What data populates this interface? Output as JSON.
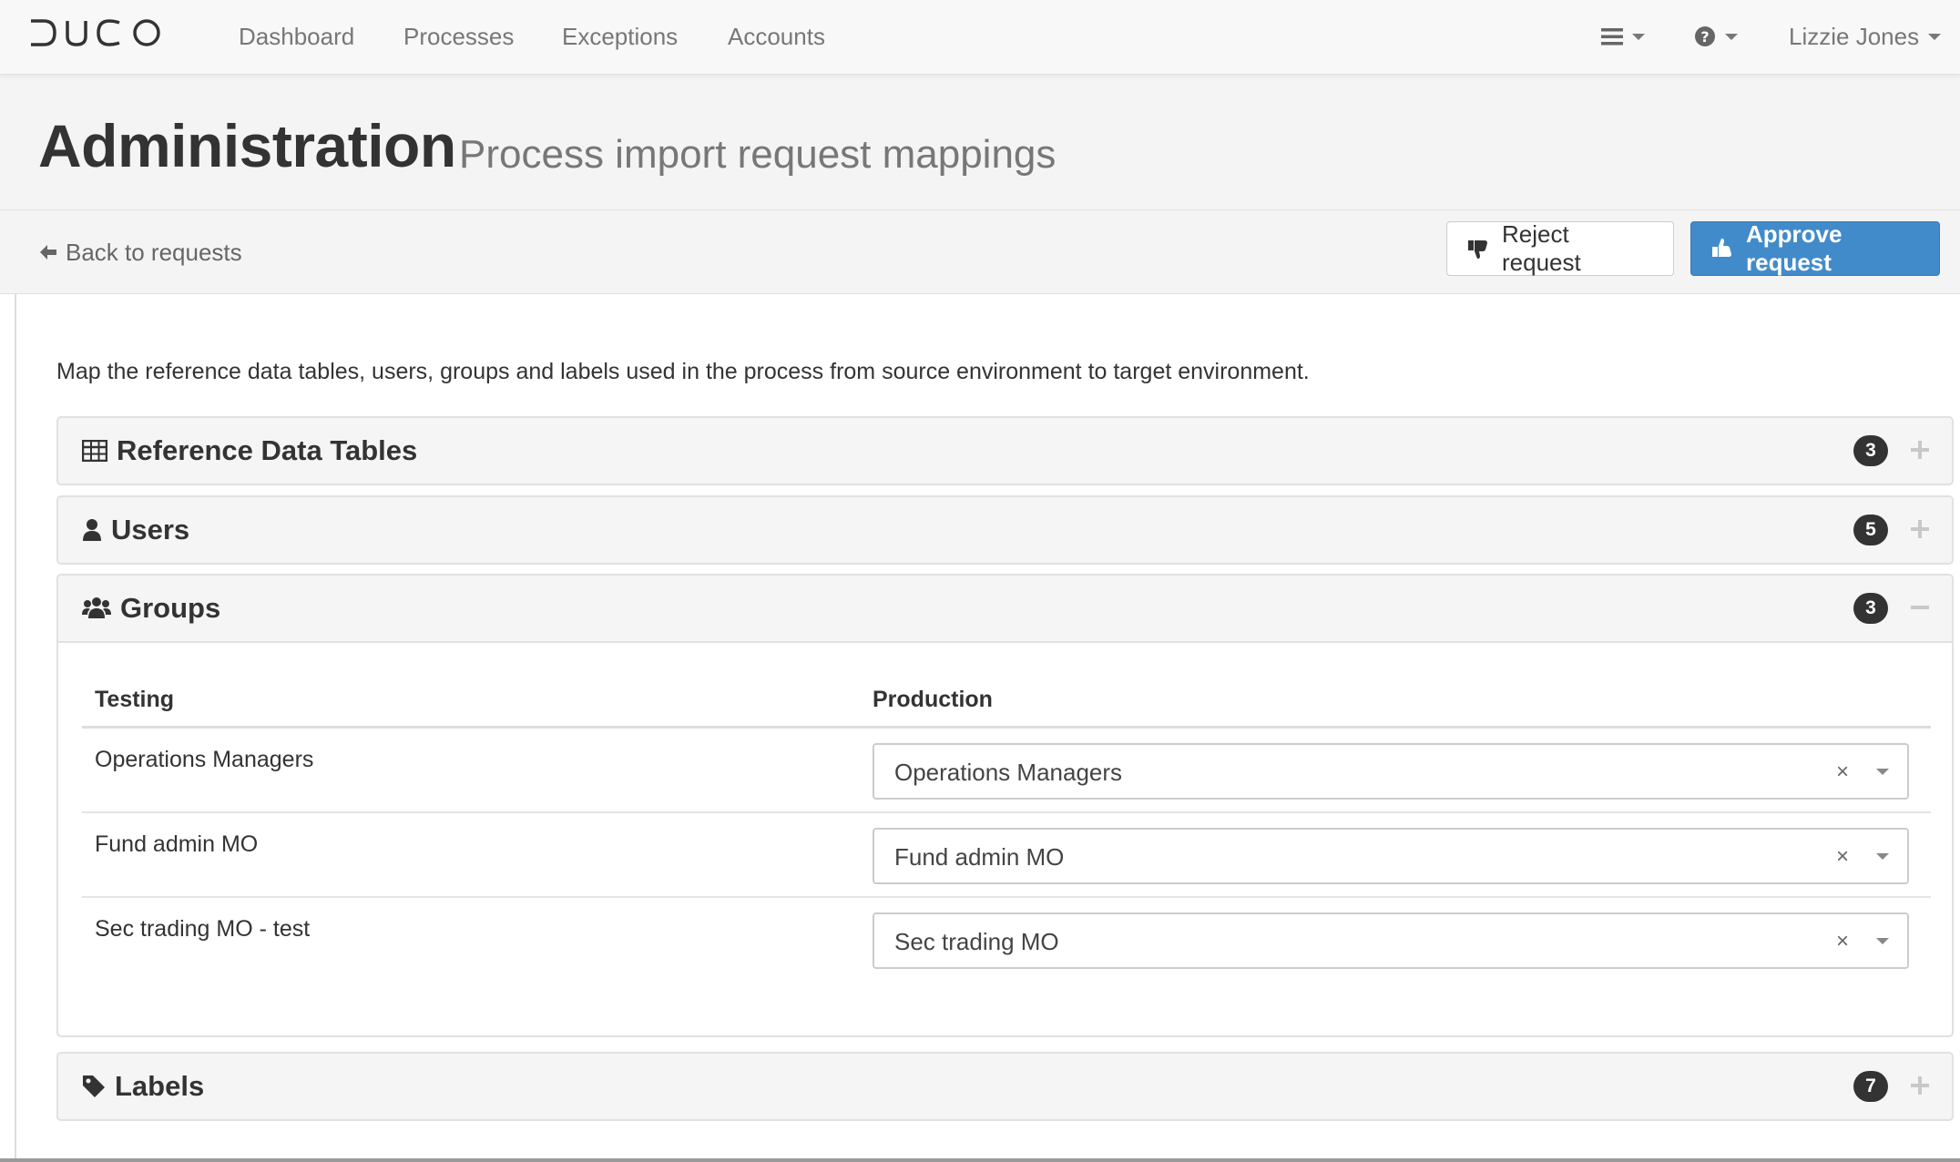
{
  "brand": {
    "logo_text": "DUCO"
  },
  "nav": {
    "items": [
      {
        "label": "Dashboard"
      },
      {
        "label": "Processes"
      },
      {
        "label": "Exceptions"
      },
      {
        "label": "Accounts"
      }
    ],
    "menu_icon": "hamburger-menu-icon",
    "help_icon": "question-circle-icon",
    "user_name": "Lizzie Jones"
  },
  "header": {
    "title": "Administration",
    "subtitle": "Process import request mappings"
  },
  "actions": {
    "back_label": "Back to requests",
    "reject_label": "Reject request",
    "approve_label": "Approve request",
    "approve_color": "#428bca"
  },
  "intro_text": "Map the reference data tables, users, groups and labels used in the process from source environment to target environment.",
  "panels": {
    "reference_data_tables": {
      "title": "Reference Data Tables",
      "count": "3",
      "icon": "table-icon",
      "expanded": false
    },
    "users": {
      "title": "Users",
      "count": "5",
      "icon": "user-icon",
      "expanded": false
    },
    "groups": {
      "title": "Groups",
      "count": "3",
      "icon": "group-icon",
      "expanded": true,
      "columns": {
        "source": "Testing",
        "target": "Production"
      },
      "rows": [
        {
          "source": "Operations Managers",
          "target": "Operations Managers"
        },
        {
          "source": "Fund admin MO",
          "target": "Fund admin MO"
        },
        {
          "source": "Sec trading MO - test",
          "target": "Sec trading MO"
        }
      ],
      "clear_glyph": "×"
    },
    "labels": {
      "title": "Labels",
      "count": "7",
      "icon": "tag-icon",
      "expanded": false
    }
  }
}
